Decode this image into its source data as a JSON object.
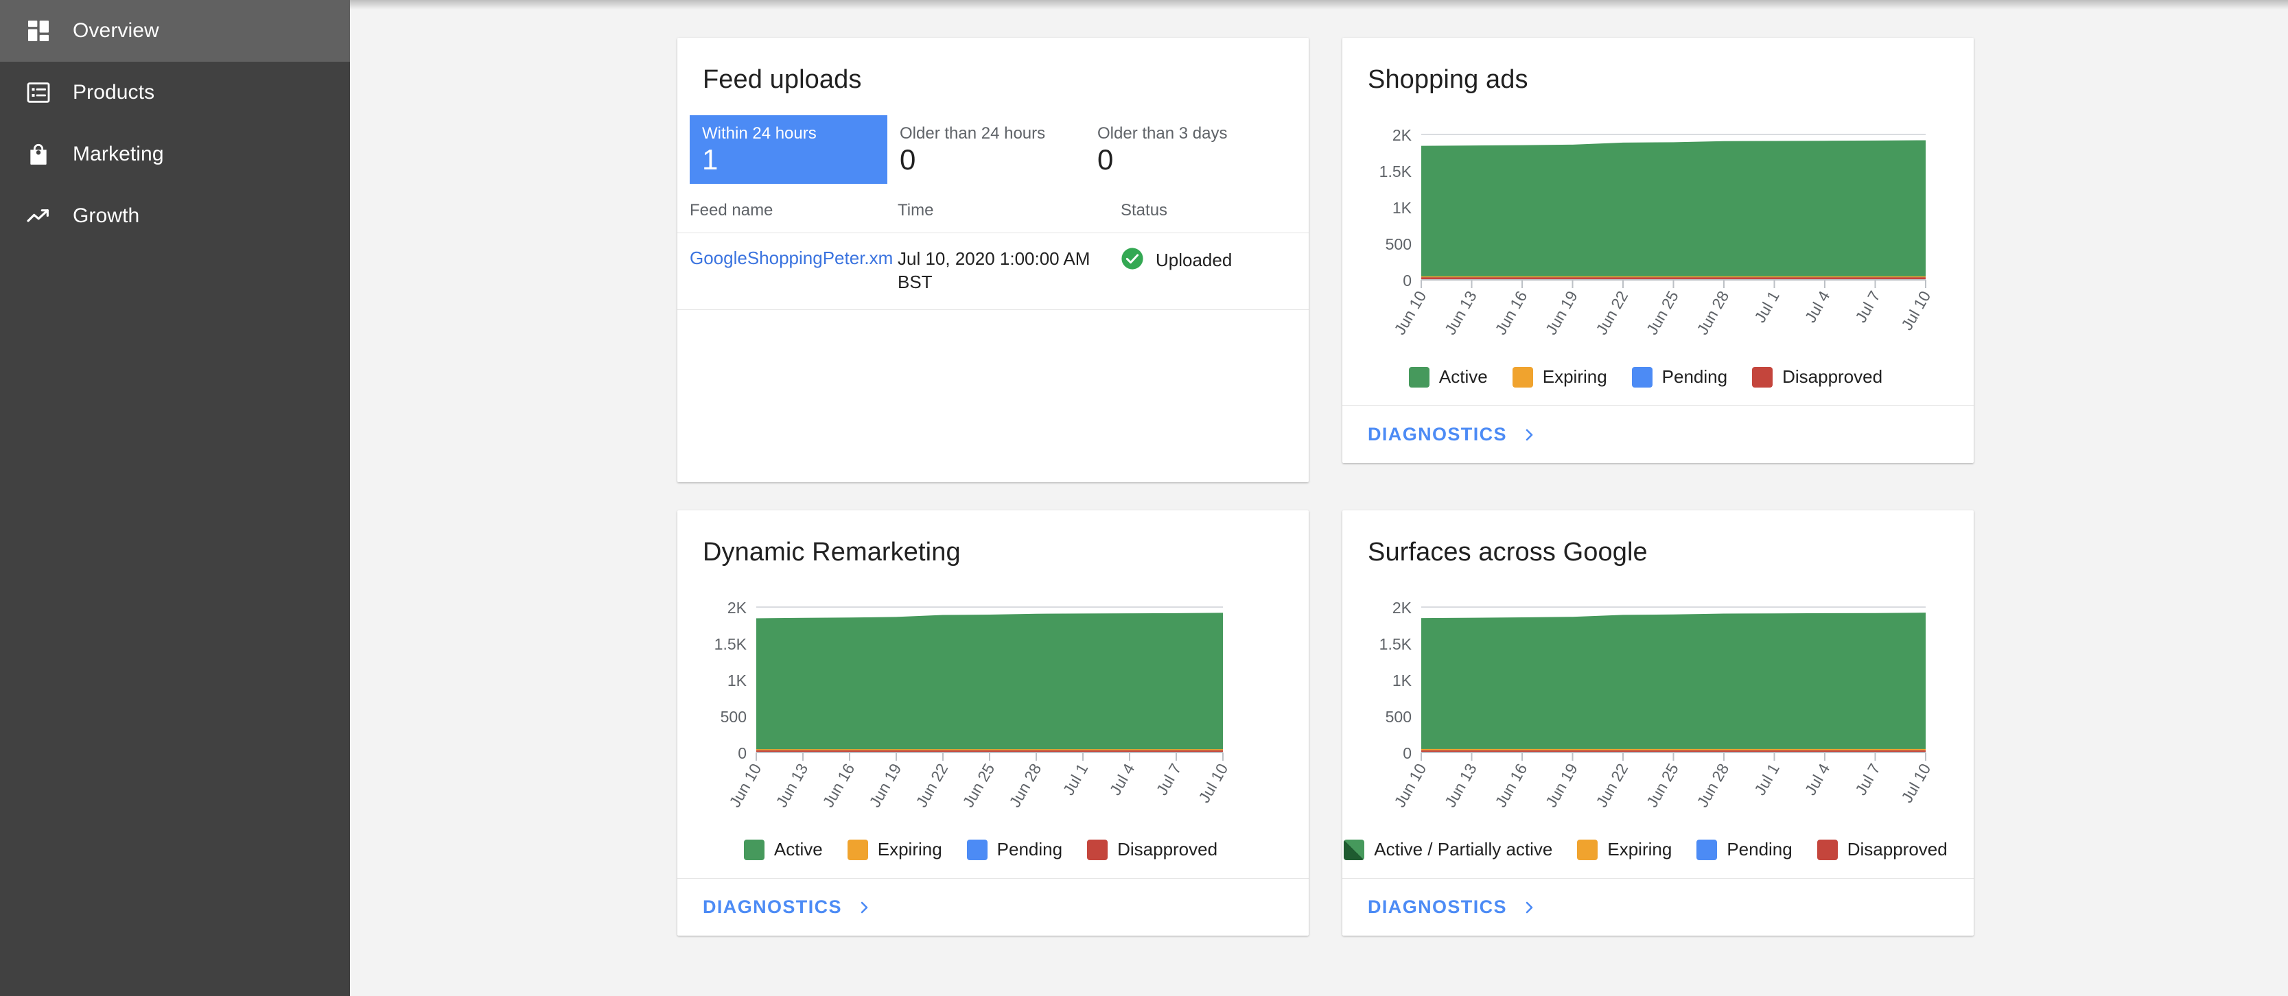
{
  "sidebar": {
    "items": [
      {
        "label": "Overview",
        "icon": "dashboard-icon",
        "active": true
      },
      {
        "label": "Products",
        "icon": "list-icon",
        "active": false
      },
      {
        "label": "Marketing",
        "icon": "shopping-bag-icon",
        "active": false
      },
      {
        "label": "Growth",
        "icon": "trending-up-icon",
        "active": false
      }
    ]
  },
  "feed_card": {
    "title": "Feed uploads",
    "tiles": [
      {
        "label": "Within 24 hours",
        "value": "1",
        "selected": true
      },
      {
        "label": "Older than 24 hours",
        "value": "0",
        "selected": false
      },
      {
        "label": "Older than 3 days",
        "value": "0",
        "selected": false
      }
    ],
    "columns": [
      "Feed name",
      "Time",
      "Status"
    ],
    "rows": [
      {
        "name": "GoogleShoppingPeter.xm",
        "time": "Jul 10, 2020 1:00:00 AM BST",
        "status": "Uploaded",
        "status_icon": "check-circle-icon"
      }
    ]
  },
  "shopping_ads_card": {
    "title": "Shopping ads",
    "diagnostics_label": "DIAGNOSTICS"
  },
  "dynamic_remarketing_card": {
    "title": "Dynamic Remarketing",
    "diagnostics_label": "DIAGNOSTICS"
  },
  "surfaces_card": {
    "title": "Surfaces across Google",
    "diagnostics_label": "DIAGNOSTICS"
  },
  "colors": {
    "active_green": "#46995c",
    "active_dark_green": "#1e5b30",
    "expiring_orange": "#f0a32e",
    "pending_blue": "#4c8bf5",
    "disapproved_red": "#c4453c",
    "link_blue": "#4c8bf5",
    "sidebar_bg": "#414141",
    "sidebar_active_bg": "#616161"
  },
  "chart_data": [
    {
      "id": "shopping-ads",
      "type": "area",
      "title": "Shopping ads",
      "xlabel": "",
      "ylabel": "",
      "ylim": [
        0,
        2000
      ],
      "ytick_labels": [
        "0",
        "500",
        "1K",
        "1.5K",
        "2K"
      ],
      "ytick_values": [
        0,
        500,
        1000,
        1500,
        2000
      ],
      "grid": true,
      "legend_position": "bottom-center",
      "x": [
        "Jun 10",
        "Jun 13",
        "Jun 16",
        "Jun 19",
        "Jun 22",
        "Jun 25",
        "Jun 28",
        "Jul 1",
        "Jul 4",
        "Jul 7",
        "Jul 10"
      ],
      "series": [
        {
          "name": "Active",
          "color": "#46995c",
          "values": [
            1795,
            1800,
            1805,
            1812,
            1840,
            1845,
            1860,
            1862,
            1865,
            1868,
            1872
          ]
        },
        {
          "name": "Expiring",
          "color": "#f0a32e",
          "values": [
            14,
            14,
            14,
            14,
            14,
            14,
            14,
            14,
            14,
            14,
            14
          ]
        },
        {
          "name": "Pending",
          "color": "#4c8bf5",
          "values": [
            0,
            0,
            0,
            0,
            0,
            0,
            0,
            0,
            0,
            0,
            0
          ]
        },
        {
          "name": "Disapproved",
          "color": "#c4453c",
          "values": [
            34,
            34,
            34,
            34,
            34,
            34,
            34,
            34,
            34,
            34,
            34
          ]
        }
      ]
    },
    {
      "id": "dynamic-remarketing",
      "type": "area",
      "title": "Dynamic Remarketing",
      "xlabel": "",
      "ylabel": "",
      "ylim": [
        0,
        2000
      ],
      "ytick_labels": [
        "0",
        "500",
        "1K",
        "1.5K",
        "2K"
      ],
      "ytick_values": [
        0,
        500,
        1000,
        1500,
        2000
      ],
      "grid": true,
      "legend_position": "bottom-center",
      "x": [
        "Jun 10",
        "Jun 13",
        "Jun 16",
        "Jun 19",
        "Jun 22",
        "Jun 25",
        "Jun 28",
        "Jul 1",
        "Jul 4",
        "Jul 7",
        "Jul 10"
      ],
      "series": [
        {
          "name": "Active",
          "color": "#46995c",
          "values": [
            1800,
            1805,
            1810,
            1818,
            1845,
            1850,
            1862,
            1865,
            1868,
            1870,
            1875
          ]
        },
        {
          "name": "Expiring",
          "color": "#f0a32e",
          "values": [
            16,
            16,
            16,
            16,
            16,
            16,
            16,
            16,
            16,
            16,
            16
          ]
        },
        {
          "name": "Pending",
          "color": "#4c8bf5",
          "values": [
            0,
            0,
            0,
            0,
            0,
            0,
            0,
            0,
            0,
            0,
            0
          ]
        },
        {
          "name": "Disapproved",
          "color": "#c4453c",
          "values": [
            30,
            30,
            30,
            30,
            30,
            30,
            30,
            30,
            30,
            30,
            30
          ]
        }
      ]
    },
    {
      "id": "surfaces-across-google",
      "type": "area",
      "title": "Surfaces across Google",
      "xlabel": "",
      "ylabel": "",
      "ylim": [
        0,
        2000
      ],
      "ytick_labels": [
        "0",
        "500",
        "1K",
        "1.5K",
        "2K"
      ],
      "ytick_values": [
        0,
        500,
        1000,
        1500,
        2000
      ],
      "grid": true,
      "legend_position": "bottom-center",
      "x": [
        "Jun 10",
        "Jun 13",
        "Jun 16",
        "Jun 19",
        "Jun 22",
        "Jun 25",
        "Jun 28",
        "Jul 1",
        "Jul 4",
        "Jul 7",
        "Jul 10"
      ],
      "series": [
        {
          "name": "Active / Partially active",
          "color": "#46995c",
          "values": [
            1800,
            1805,
            1810,
            1818,
            1845,
            1850,
            1862,
            1865,
            1868,
            1870,
            1875
          ]
        },
        {
          "name": "Expiring",
          "color": "#f0a32e",
          "values": [
            18,
            18,
            18,
            18,
            18,
            18,
            18,
            18,
            18,
            18,
            18
          ]
        },
        {
          "name": "Pending",
          "color": "#4c8bf5",
          "values": [
            0,
            0,
            0,
            0,
            0,
            0,
            0,
            0,
            0,
            0,
            0
          ]
        },
        {
          "name": "Disapproved",
          "color": "#c4453c",
          "values": [
            30,
            30,
            30,
            30,
            30,
            30,
            30,
            30,
            30,
            30,
            30
          ]
        }
      ]
    }
  ],
  "legends": {
    "standard": [
      {
        "label": "Active",
        "color": "#46995c",
        "style": "solid"
      },
      {
        "label": "Expiring",
        "color": "#f0a32e",
        "style": "solid"
      },
      {
        "label": "Pending",
        "color": "#4c8bf5",
        "style": "solid"
      },
      {
        "label": "Disapproved",
        "color": "#c4453c",
        "style": "solid"
      }
    ],
    "surfaces": [
      {
        "label": "Active / Partially active",
        "color": "#46995c",
        "style": "split"
      },
      {
        "label": "Expiring",
        "color": "#f0a32e",
        "style": "solid"
      },
      {
        "label": "Pending",
        "color": "#4c8bf5",
        "style": "solid"
      },
      {
        "label": "Disapproved",
        "color": "#c4453c",
        "style": "solid"
      }
    ]
  }
}
